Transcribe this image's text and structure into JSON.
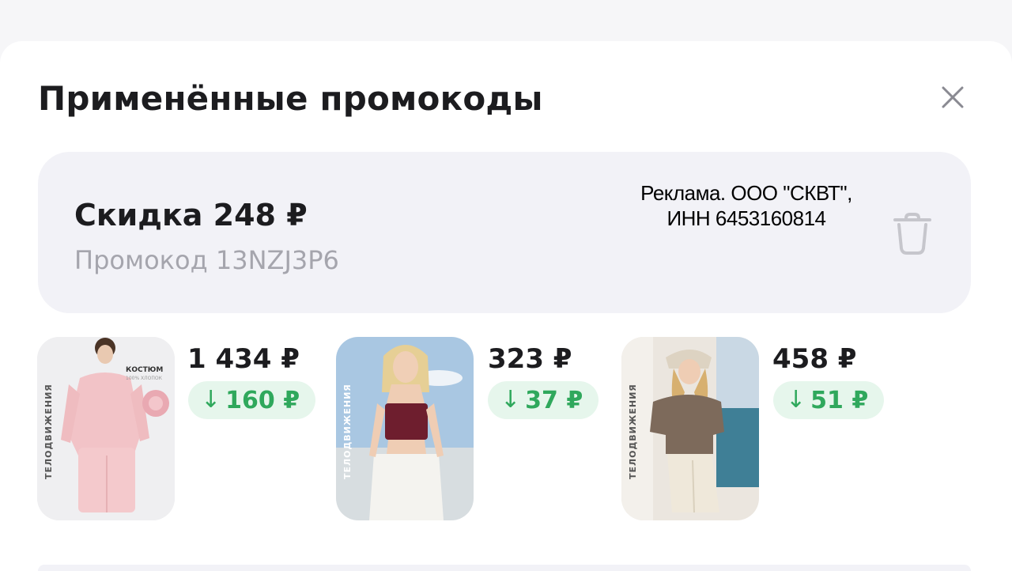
{
  "header": {
    "title": "Применённые промокоды",
    "close_icon": "close-icon"
  },
  "promo": {
    "title": "Скидка 248 ₽",
    "code_line": "Промокод 13NZJ3P6",
    "ad_line1": "Реклама. ООО \"СКВТ\",",
    "ad_line2": "ИНН 6453160814",
    "delete_icon": "trash-icon"
  },
  "products": [
    {
      "price": "1 434 ₽",
      "discount": "160 ₽",
      "brand": "ТЕЛОДВИЖЕНИЯ",
      "tag": "КОСТЮМ",
      "tag_sub": "100% ХЛОПОК"
    },
    {
      "price": "323 ₽",
      "discount": "37 ₽",
      "brand": "ТЕЛОДВИЖЕНИЯ"
    },
    {
      "price": "458 ₽",
      "discount": "51 ₽",
      "brand": "ТЕЛОДВИЖЕНИЯ"
    }
  ],
  "colors": {
    "accent_green": "#2fa85c",
    "pill_green_bg": "#e6f6ec",
    "card_bg": "#f2f2f7"
  }
}
